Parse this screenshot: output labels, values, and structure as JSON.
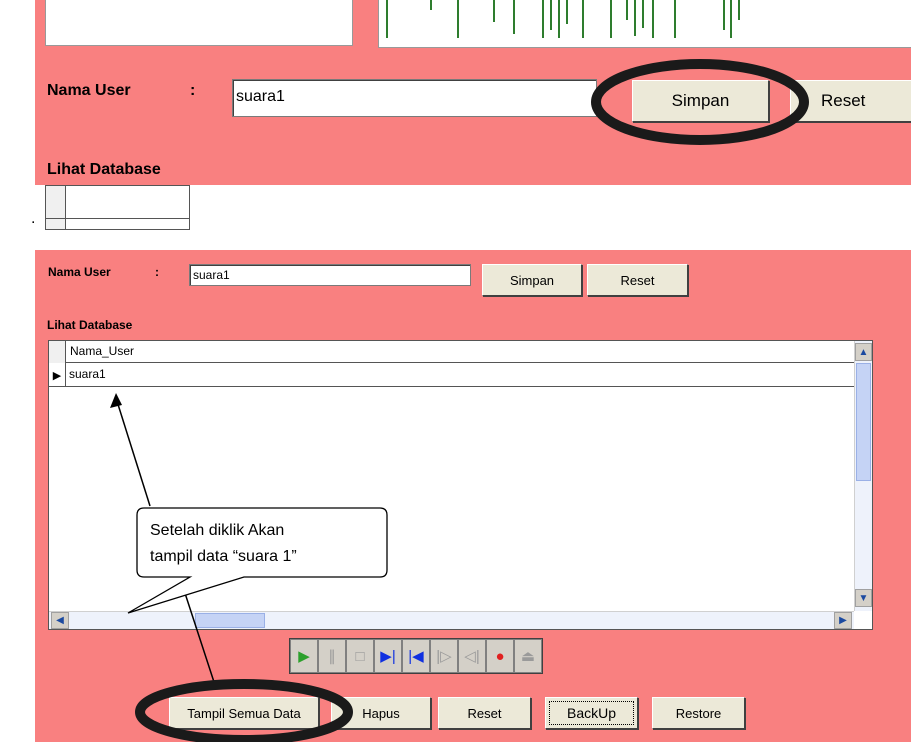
{
  "top": {
    "nama_user_label": "Nama User",
    "colon": ":",
    "nama_user_value": "suara1",
    "simpan_label": "Simpan",
    "reset_label": "Reset",
    "lihat_database_label": "Lihat Database",
    "bullet": "."
  },
  "bottom": {
    "nama_user_label": "Nama User",
    "colon": ":",
    "nama_user_value": "suara1",
    "simpan_label": "Simpan",
    "reset_label": "Reset",
    "lihat_database_label": "Lihat Database",
    "grid": {
      "column_header": "Nama_User",
      "rows": [
        "suara1"
      ]
    },
    "callout": {
      "line1": "Setelah diklik Akan",
      "line2": "tampil data “suara 1”"
    },
    "media_controls": [
      {
        "name": "play-icon",
        "glyph": "▶",
        "color": "#2ca02c"
      },
      {
        "name": "pause-icon",
        "glyph": "∥",
        "color": "#9a9a9a"
      },
      {
        "name": "stop-icon",
        "glyph": "□",
        "color": "#9a9a9a"
      },
      {
        "name": "next-icon",
        "glyph": "▶|",
        "color": "#1030e0"
      },
      {
        "name": "previous-icon",
        "glyph": "|◀",
        "color": "#1030e0"
      },
      {
        "name": "step-forward-icon",
        "glyph": "|▷",
        "color": "#9a9a9a"
      },
      {
        "name": "step-back-icon",
        "glyph": "◁|",
        "color": "#9a9a9a"
      },
      {
        "name": "record-icon",
        "glyph": "●",
        "color": "#e02020"
      },
      {
        "name": "eject-icon",
        "glyph": "⏏",
        "color": "#9a9a9a"
      }
    ],
    "buttons": {
      "tampil_semua_data": "Tampil Semua Data",
      "hapus": "Hapus",
      "reset": "Reset",
      "backup": "BackUp",
      "restore": "Restore"
    }
  },
  "colors": {
    "panel_bg": "#f98080",
    "button_face": "#ece9d8",
    "highlight_ring": "#1a1a1a"
  }
}
